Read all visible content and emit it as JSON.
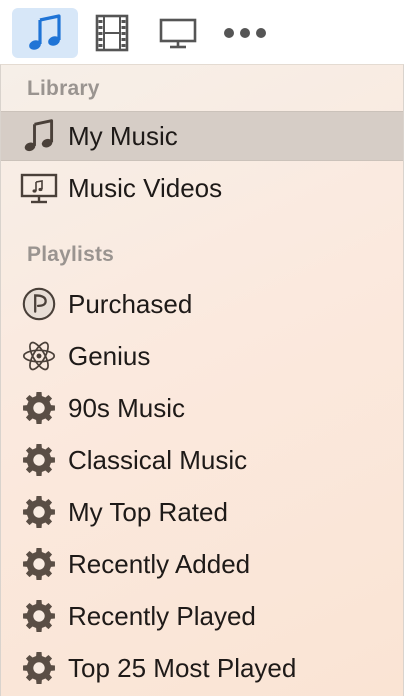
{
  "toolbar": {
    "buttons": [
      {
        "icon": "music-note-icon",
        "active": true
      },
      {
        "icon": "film-strip-icon",
        "active": false
      },
      {
        "icon": "tv-monitor-icon",
        "active": false
      },
      {
        "icon": "more-dots-icon",
        "active": false
      }
    ],
    "accent_color": "#1f74d6",
    "icon_color": "#555555"
  },
  "sidebar": {
    "library_header": "Library",
    "library_items": [
      {
        "label": "My Music",
        "icon": "music-note-icon",
        "selected": true
      },
      {
        "label": "Music Videos",
        "icon": "music-video-icon",
        "selected": false
      }
    ],
    "playlists_header": "Playlists",
    "playlist_items": [
      {
        "label": "Purchased",
        "icon": "purchased-icon"
      },
      {
        "label": "Genius",
        "icon": "genius-atom-icon"
      },
      {
        "label": "90s Music",
        "icon": "smart-playlist-gear-icon"
      },
      {
        "label": "Classical Music",
        "icon": "smart-playlist-gear-icon"
      },
      {
        "label": "My Top Rated",
        "icon": "smart-playlist-gear-icon"
      },
      {
        "label": "Recently Added",
        "icon": "smart-playlist-gear-icon"
      },
      {
        "label": "Recently Played",
        "icon": "smart-playlist-gear-icon"
      },
      {
        "label": "Top 25 Most Played",
        "icon": "smart-playlist-gear-icon"
      }
    ],
    "icon_color": "#5a4e45"
  }
}
